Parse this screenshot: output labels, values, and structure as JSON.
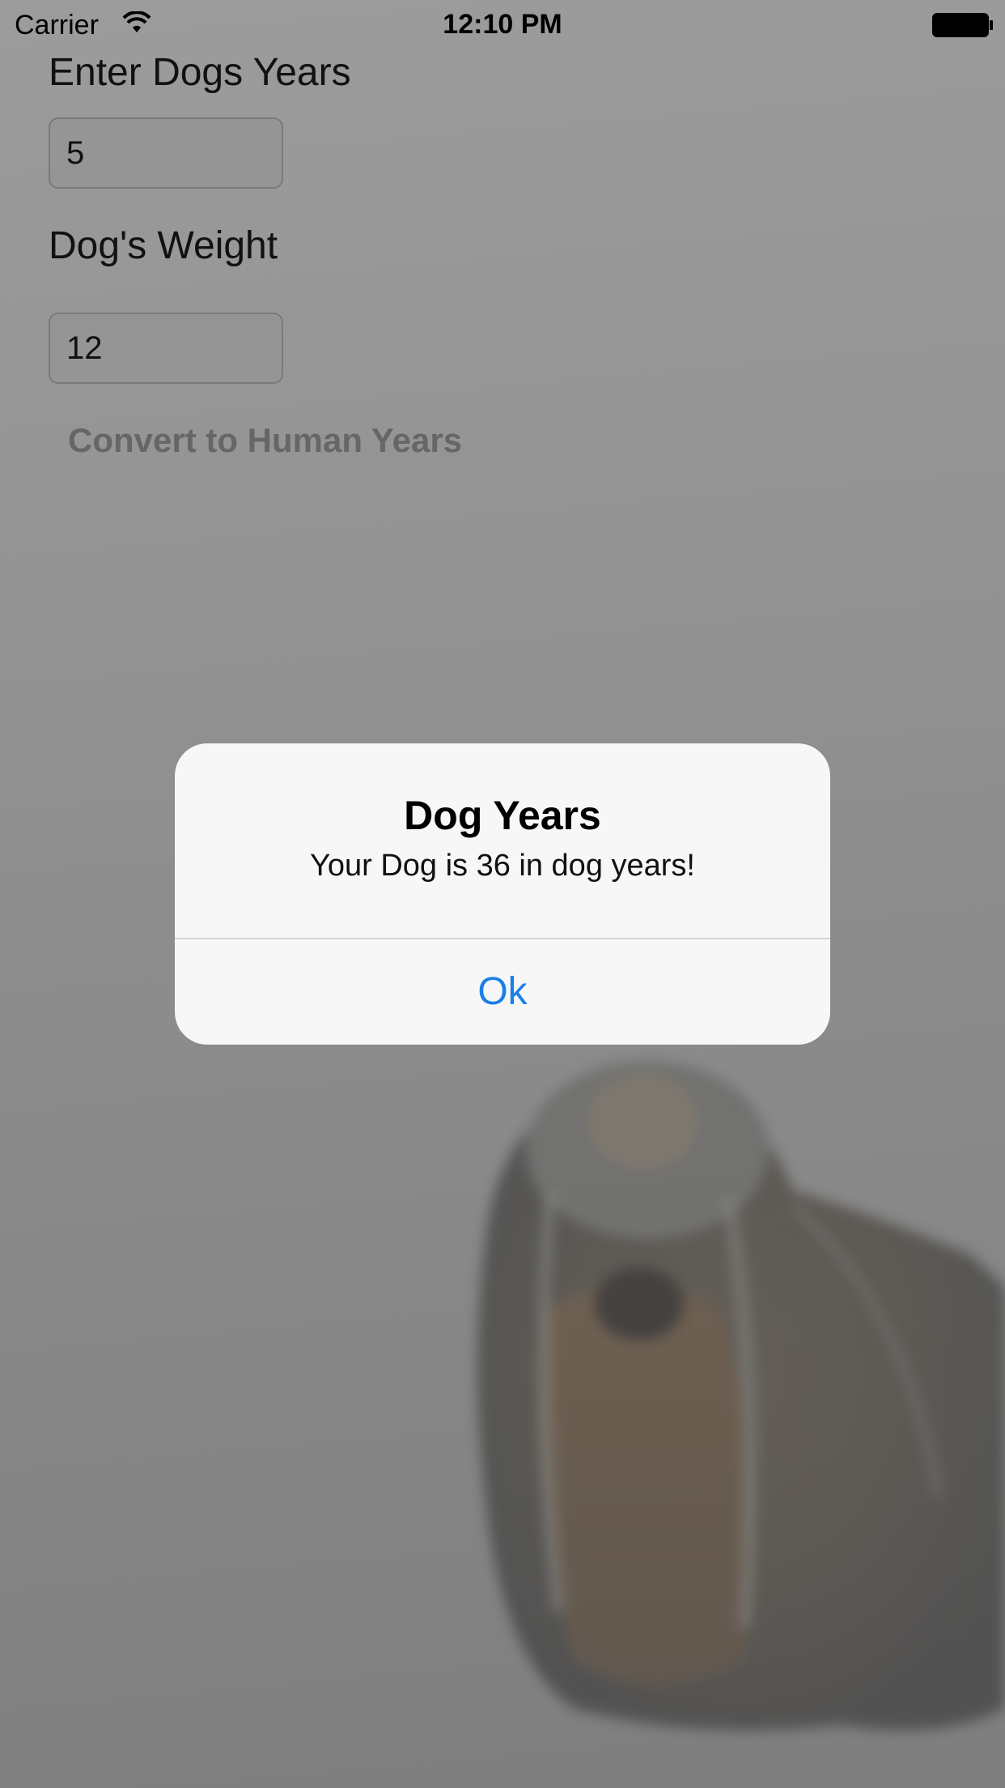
{
  "status_bar": {
    "carrier": "Carrier",
    "time": "12:10 PM",
    "icons": [
      "wifi-icon",
      "battery-icon"
    ]
  },
  "form": {
    "years_label": "Enter Dogs Years",
    "years_value": "5",
    "weight_label": "Dog's Weight",
    "weight_value": "12",
    "convert_label": "Convert to Human Years"
  },
  "alert": {
    "title": "Dog Years",
    "message": "Your Dog is 36 in dog years!",
    "button_label": "Ok"
  },
  "colors": {
    "alert_button": "#1a7fe8",
    "dim_background": "#8f8f8f"
  }
}
